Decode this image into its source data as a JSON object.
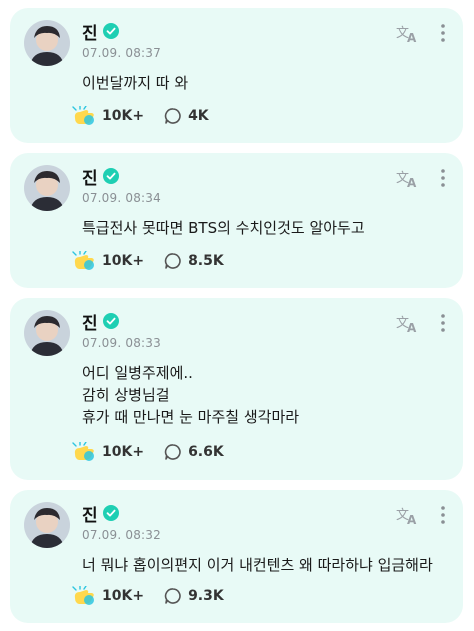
{
  "posts": [
    {
      "author": "진",
      "time": "07.09. 08:37",
      "lines": [
        "이번달까지 따 와"
      ],
      "likes": "10K+",
      "comments": "4K"
    },
    {
      "author": "진",
      "time": "07.09. 08:34",
      "lines": [
        "특급전사 못따면 BTS의 수치인것도 알아두고"
      ],
      "likes": "10K+",
      "comments": "8.5K"
    },
    {
      "author": "진",
      "time": "07.09. 08:33",
      "lines": [
        "어디 일병주제에..",
        "감히 상병님걸",
        "휴가 때 만나면 눈 마주칠 생각마라"
      ],
      "likes": "10K+",
      "comments": "6.6K"
    },
    {
      "author": "진",
      "time": "07.09. 08:32",
      "lines": [
        "너 뭐냐 홉이의편지 이거 내컨텐츠 왜 따라하냐 입금해라"
      ],
      "likes": "10K+",
      "comments": "9.3K"
    }
  ],
  "icons": {
    "verified": "verified-badge-icon",
    "translate": "translate-icon",
    "more": "more-vertical-icon",
    "like": "cheer-hand-icon",
    "comment": "comment-bubble-icon"
  },
  "colors": {
    "card_background": "#e8faf6",
    "accent": "#1ecfb3",
    "timestamp": "#8a8f94"
  }
}
